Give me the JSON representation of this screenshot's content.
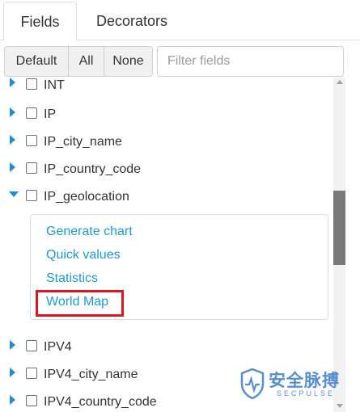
{
  "tabs": [
    {
      "label": "Fields",
      "active": true
    },
    {
      "label": "Decorators",
      "active": false
    }
  ],
  "toolbar": {
    "default_label": "Default",
    "all_label": "All",
    "none_label": "None",
    "filter_placeholder": "Filter fields",
    "filter_value": ""
  },
  "fields": [
    {
      "name": "INT",
      "expanded": false
    },
    {
      "name": "IP",
      "expanded": false
    },
    {
      "name": "IP_city_name",
      "expanded": false
    },
    {
      "name": "IP_country_code",
      "expanded": false
    },
    {
      "name": "IP_geolocation",
      "expanded": true
    },
    {
      "name": "IPV4",
      "expanded": false
    },
    {
      "name": "IPV4_city_name",
      "expanded": false
    },
    {
      "name": "IPV4_country_code",
      "expanded": false
    }
  ],
  "actions": [
    {
      "label": "Generate chart"
    },
    {
      "label": "Quick values"
    },
    {
      "label": "Statistics"
    },
    {
      "label": "World Map",
      "highlighted": true
    }
  ],
  "watermark": {
    "title": "安全脉搏",
    "subtitle": "SECPULSE"
  },
  "colors": {
    "link": "#1b9bd4",
    "caret": "#1a8fd6",
    "highlight": "#d9171e"
  }
}
